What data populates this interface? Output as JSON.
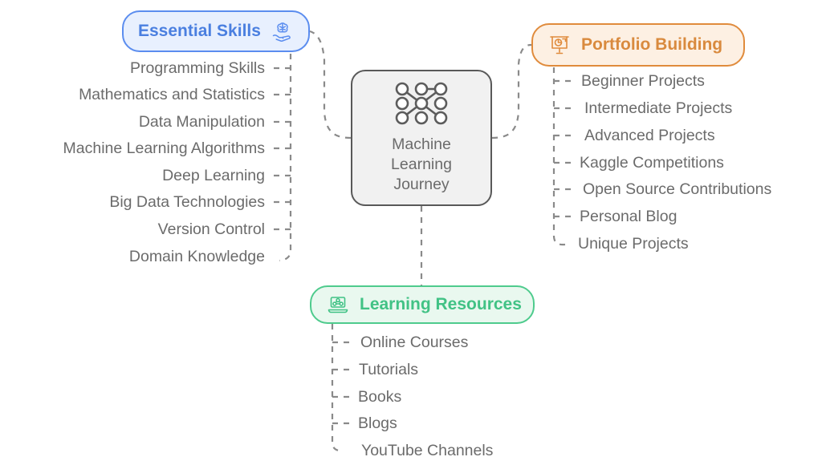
{
  "diagram": {
    "type": "mindmap",
    "background": "#ffffff",
    "center": {
      "label": "Machine\nLearning\nJourney",
      "icon": "neural-network-icon",
      "fill": "#f1f1f1",
      "border": "#595959",
      "text_color": "#6b6b6b"
    },
    "branches": [
      {
        "id": "essential-skills",
        "label": "Essential Skills",
        "icon": "brain-in-hand-icon",
        "icon_position": "right",
        "accent": "#5b8def",
        "fill": "#e8f0fe",
        "text_color": "#4a7fe0",
        "side": "left",
        "children": [
          "Programming Skills",
          "Mathematics and Statistics",
          "Data Manipulation",
          "Machine Learning Algorithms",
          "Deep Learning",
          "Big Data Technologies",
          "Version Control",
          "Domain Knowledge"
        ]
      },
      {
        "id": "portfolio-building",
        "label": "Portfolio Building",
        "icon": "presentation-chart-icon",
        "icon_position": "left",
        "accent": "#e08b3c",
        "fill": "#fdf0e3",
        "text_color": "#d98a3e",
        "side": "right",
        "children": [
          "Beginner Projects",
          "Intermediate Projects",
          "Advanced Projects",
          "Kaggle Competitions",
          "Open Source Contributions",
          "Personal Blog",
          "Unique Projects"
        ]
      },
      {
        "id": "learning-resources",
        "label": "Learning Resources",
        "icon": "laptop-network-icon",
        "icon_position": "left",
        "accent": "#4ecb8d",
        "fill": "#e9f8ef",
        "text_color": "#41c285",
        "side": "bottom",
        "children": [
          "Online Courses",
          "Tutorials",
          "Books",
          "Blogs",
          "YouTube Channels"
        ]
      }
    ],
    "connector": {
      "color": "#8a8a8a",
      "style": "dashed"
    }
  }
}
